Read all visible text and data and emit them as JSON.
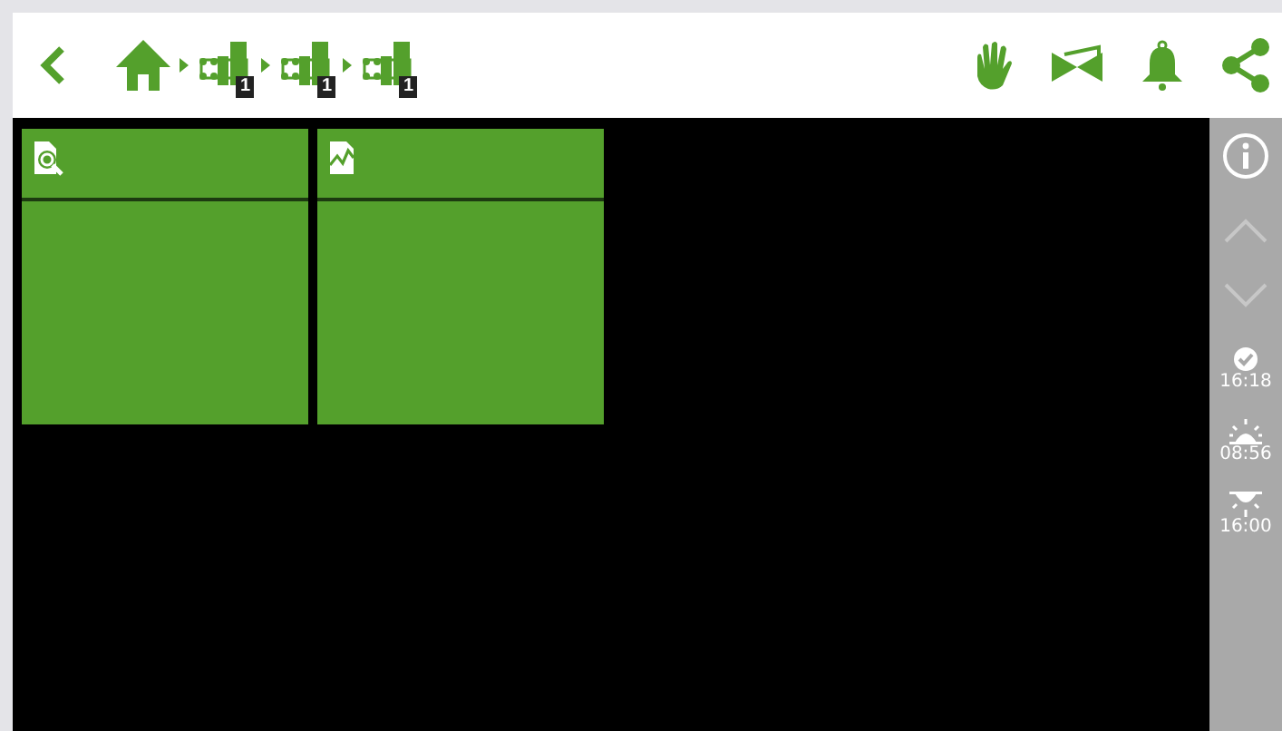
{
  "toolbar": {
    "breadcrumbs": [
      {
        "badge": "1"
      },
      {
        "badge": "1"
      },
      {
        "badge": "1"
      }
    ]
  },
  "tiles": [
    {
      "kind": "search"
    },
    {
      "kind": "chart"
    }
  ],
  "sidebar": {
    "scroll_up": {
      "disabled": true
    },
    "scroll_down": {
      "disabled": true
    },
    "events": [
      {
        "kind": "check",
        "time": "16:18"
      },
      {
        "kind": "sunrise",
        "time": "08:56"
      },
      {
        "kind": "sunset",
        "time": "16:00"
      }
    ]
  }
}
